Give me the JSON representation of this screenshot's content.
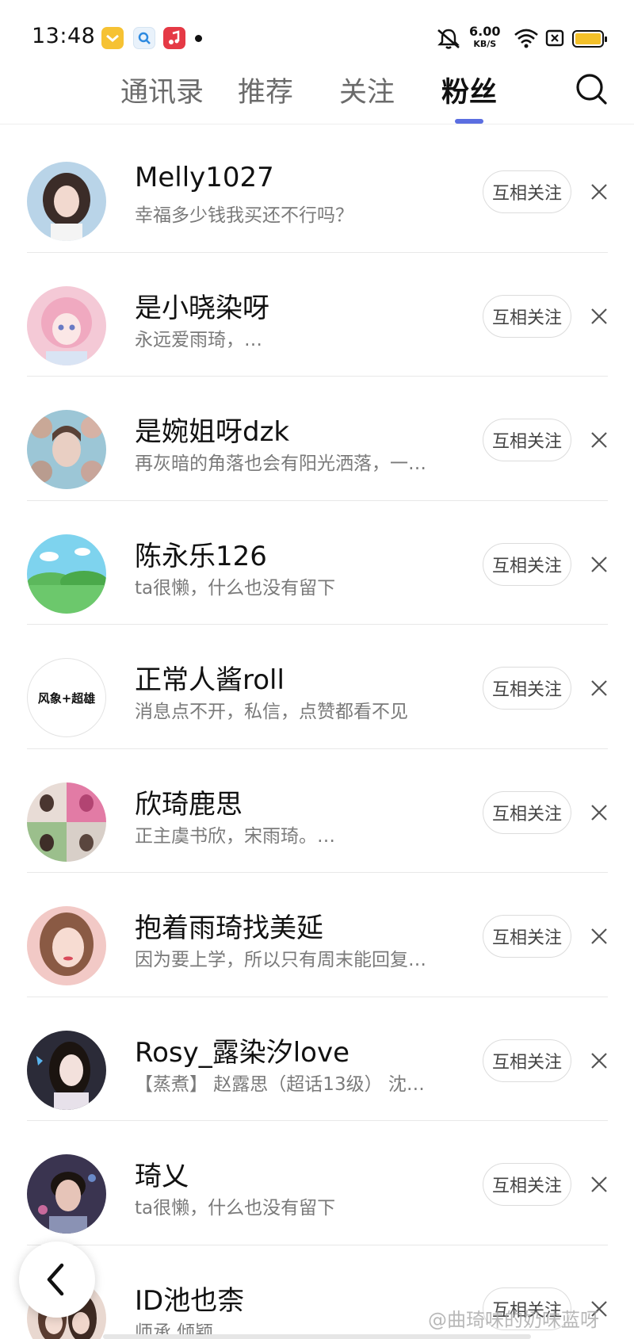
{
  "status_bar": {
    "time": "13:48",
    "speed_value": "6.00",
    "speed_unit": "KB/S",
    "app_icons": [
      "notes-app-icon",
      "search-app-icon",
      "music-app-icon"
    ],
    "battery_color": "#f4c12a"
  },
  "tabs": [
    {
      "label": "通讯录",
      "active": false
    },
    {
      "label": "推荐",
      "active": false
    },
    {
      "label": "关注",
      "active": false
    },
    {
      "label": "粉丝",
      "active": true
    }
  ],
  "accent_color": "#5b6ee1",
  "follow_label": "互相关注",
  "fans": [
    {
      "name": "Melly1027",
      "bio": "幸福多少钱我买还不行吗？",
      "avatar": "photo-girl"
    },
    {
      "name": "是小晓染呀",
      "bio": "永远爱雨琦，…",
      "avatar": "anime-pink"
    },
    {
      "name": "是婉姐呀dzk",
      "bio": "再灰暗的角落也会有阳光洒落，一…",
      "avatar": "collage-blue"
    },
    {
      "name": "陈永乐126",
      "bio": "ta很懒，什么也没有留下",
      "avatar": "landscape-default"
    },
    {
      "name": "正常人酱roll",
      "bio": "消息点不开，私信，点赞都看不见",
      "avatar": "text-avatar",
      "avatar_text": "风象+超雄"
    },
    {
      "name": "欣琦鹿思",
      "bio": "正主虞书欣，宋雨琦。…",
      "avatar": "collage-four"
    },
    {
      "name": "抱着雨琦找美延",
      "bio": "因为要上学，所以只有周末能回复…",
      "avatar": "photo-pink"
    },
    {
      "name": "Rosy_露染汐love",
      "bio": "【蒸煮】 赵露思（超话13级）  沈…",
      "avatar": "photo-dark"
    },
    {
      "name": "琦乂",
      "bio": "ta很懒，什么也没有留下",
      "avatar": "photo-boy"
    },
    {
      "name": "ID池也柰",
      "bio": "师承.倾颖…",
      "avatar": "photo-couple"
    }
  ],
  "watermark": "@曲琦味的奶味蓝呀"
}
